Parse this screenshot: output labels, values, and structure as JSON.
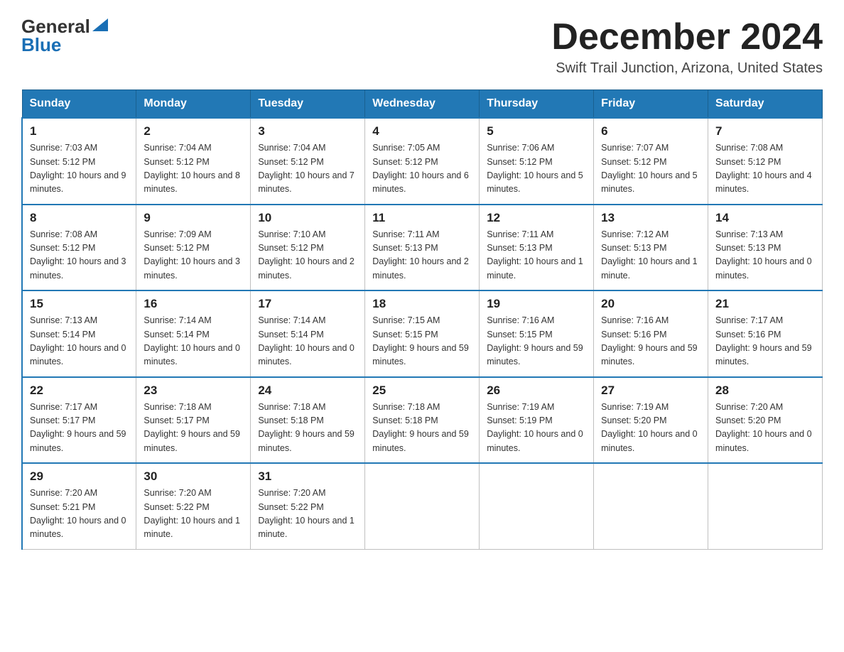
{
  "header": {
    "logo_general": "General",
    "logo_blue": "Blue",
    "month_title": "December 2024",
    "location": "Swift Trail Junction, Arizona, United States"
  },
  "days_of_week": [
    "Sunday",
    "Monday",
    "Tuesday",
    "Wednesday",
    "Thursday",
    "Friday",
    "Saturday"
  ],
  "weeks": [
    [
      {
        "day": "1",
        "sunrise": "7:03 AM",
        "sunset": "5:12 PM",
        "daylight": "10 hours and 9 minutes."
      },
      {
        "day": "2",
        "sunrise": "7:04 AM",
        "sunset": "5:12 PM",
        "daylight": "10 hours and 8 minutes."
      },
      {
        "day": "3",
        "sunrise": "7:04 AM",
        "sunset": "5:12 PM",
        "daylight": "10 hours and 7 minutes."
      },
      {
        "day": "4",
        "sunrise": "7:05 AM",
        "sunset": "5:12 PM",
        "daylight": "10 hours and 6 minutes."
      },
      {
        "day": "5",
        "sunrise": "7:06 AM",
        "sunset": "5:12 PM",
        "daylight": "10 hours and 5 minutes."
      },
      {
        "day": "6",
        "sunrise": "7:07 AM",
        "sunset": "5:12 PM",
        "daylight": "10 hours and 5 minutes."
      },
      {
        "day": "7",
        "sunrise": "7:08 AM",
        "sunset": "5:12 PM",
        "daylight": "10 hours and 4 minutes."
      }
    ],
    [
      {
        "day": "8",
        "sunrise": "7:08 AM",
        "sunset": "5:12 PM",
        "daylight": "10 hours and 3 minutes."
      },
      {
        "day": "9",
        "sunrise": "7:09 AM",
        "sunset": "5:12 PM",
        "daylight": "10 hours and 3 minutes."
      },
      {
        "day": "10",
        "sunrise": "7:10 AM",
        "sunset": "5:12 PM",
        "daylight": "10 hours and 2 minutes."
      },
      {
        "day": "11",
        "sunrise": "7:11 AM",
        "sunset": "5:13 PM",
        "daylight": "10 hours and 2 minutes."
      },
      {
        "day": "12",
        "sunrise": "7:11 AM",
        "sunset": "5:13 PM",
        "daylight": "10 hours and 1 minute."
      },
      {
        "day": "13",
        "sunrise": "7:12 AM",
        "sunset": "5:13 PM",
        "daylight": "10 hours and 1 minute."
      },
      {
        "day": "14",
        "sunrise": "7:13 AM",
        "sunset": "5:13 PM",
        "daylight": "10 hours and 0 minutes."
      }
    ],
    [
      {
        "day": "15",
        "sunrise": "7:13 AM",
        "sunset": "5:14 PM",
        "daylight": "10 hours and 0 minutes."
      },
      {
        "day": "16",
        "sunrise": "7:14 AM",
        "sunset": "5:14 PM",
        "daylight": "10 hours and 0 minutes."
      },
      {
        "day": "17",
        "sunrise": "7:14 AM",
        "sunset": "5:14 PM",
        "daylight": "10 hours and 0 minutes."
      },
      {
        "day": "18",
        "sunrise": "7:15 AM",
        "sunset": "5:15 PM",
        "daylight": "9 hours and 59 minutes."
      },
      {
        "day": "19",
        "sunrise": "7:16 AM",
        "sunset": "5:15 PM",
        "daylight": "9 hours and 59 minutes."
      },
      {
        "day": "20",
        "sunrise": "7:16 AM",
        "sunset": "5:16 PM",
        "daylight": "9 hours and 59 minutes."
      },
      {
        "day": "21",
        "sunrise": "7:17 AM",
        "sunset": "5:16 PM",
        "daylight": "9 hours and 59 minutes."
      }
    ],
    [
      {
        "day": "22",
        "sunrise": "7:17 AM",
        "sunset": "5:17 PM",
        "daylight": "9 hours and 59 minutes."
      },
      {
        "day": "23",
        "sunrise": "7:18 AM",
        "sunset": "5:17 PM",
        "daylight": "9 hours and 59 minutes."
      },
      {
        "day": "24",
        "sunrise": "7:18 AM",
        "sunset": "5:18 PM",
        "daylight": "9 hours and 59 minutes."
      },
      {
        "day": "25",
        "sunrise": "7:18 AM",
        "sunset": "5:18 PM",
        "daylight": "9 hours and 59 minutes."
      },
      {
        "day": "26",
        "sunrise": "7:19 AM",
        "sunset": "5:19 PM",
        "daylight": "10 hours and 0 minutes."
      },
      {
        "day": "27",
        "sunrise": "7:19 AM",
        "sunset": "5:20 PM",
        "daylight": "10 hours and 0 minutes."
      },
      {
        "day": "28",
        "sunrise": "7:20 AM",
        "sunset": "5:20 PM",
        "daylight": "10 hours and 0 minutes."
      }
    ],
    [
      {
        "day": "29",
        "sunrise": "7:20 AM",
        "sunset": "5:21 PM",
        "daylight": "10 hours and 0 minutes."
      },
      {
        "day": "30",
        "sunrise": "7:20 AM",
        "sunset": "5:22 PM",
        "daylight": "10 hours and 1 minute."
      },
      {
        "day": "31",
        "sunrise": "7:20 AM",
        "sunset": "5:22 PM",
        "daylight": "10 hours and 1 minute."
      },
      null,
      null,
      null,
      null
    ]
  ],
  "labels": {
    "sunrise": "Sunrise:",
    "sunset": "Sunset:",
    "daylight": "Daylight:"
  }
}
